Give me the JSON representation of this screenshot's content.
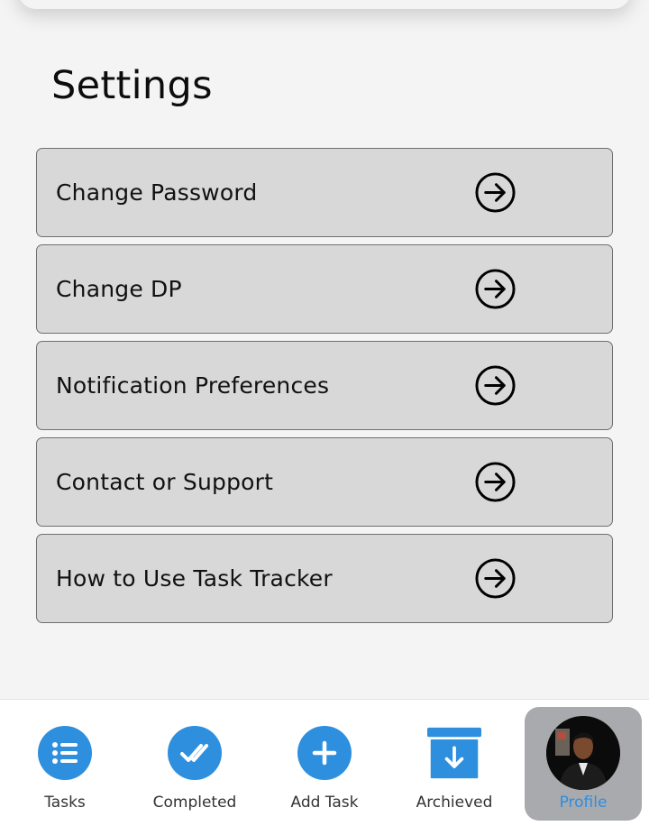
{
  "header": {
    "title": "Settings"
  },
  "menu": {
    "items": [
      {
        "label": "Change Password",
        "icon": "arrow-right-circle-icon"
      },
      {
        "label": "Change DP",
        "icon": "arrow-right-circle-icon"
      },
      {
        "label": "Notification Preferences",
        "icon": "arrow-right-circle-icon"
      },
      {
        "label": "Contact or Support",
        "icon": "arrow-right-circle-icon"
      },
      {
        "label": "How to Use Task Tracker",
        "icon": "arrow-right-circle-icon"
      }
    ]
  },
  "bottom_nav": {
    "active": "Profile",
    "items": [
      {
        "label": "Tasks",
        "icon": "list-icon"
      },
      {
        "label": "Completed",
        "icon": "double-check-icon"
      },
      {
        "label": "Add Task",
        "icon": "plus-icon"
      },
      {
        "label": "Archieved",
        "icon": "archive-icon"
      },
      {
        "label": "Profile",
        "icon": "avatar"
      }
    ]
  },
  "colors": {
    "accent": "#2e8fdf",
    "background": "#f4f4f4",
    "menu_item_bg": "#d9d8d8",
    "active_tab_bg": "#a9aaad"
  }
}
